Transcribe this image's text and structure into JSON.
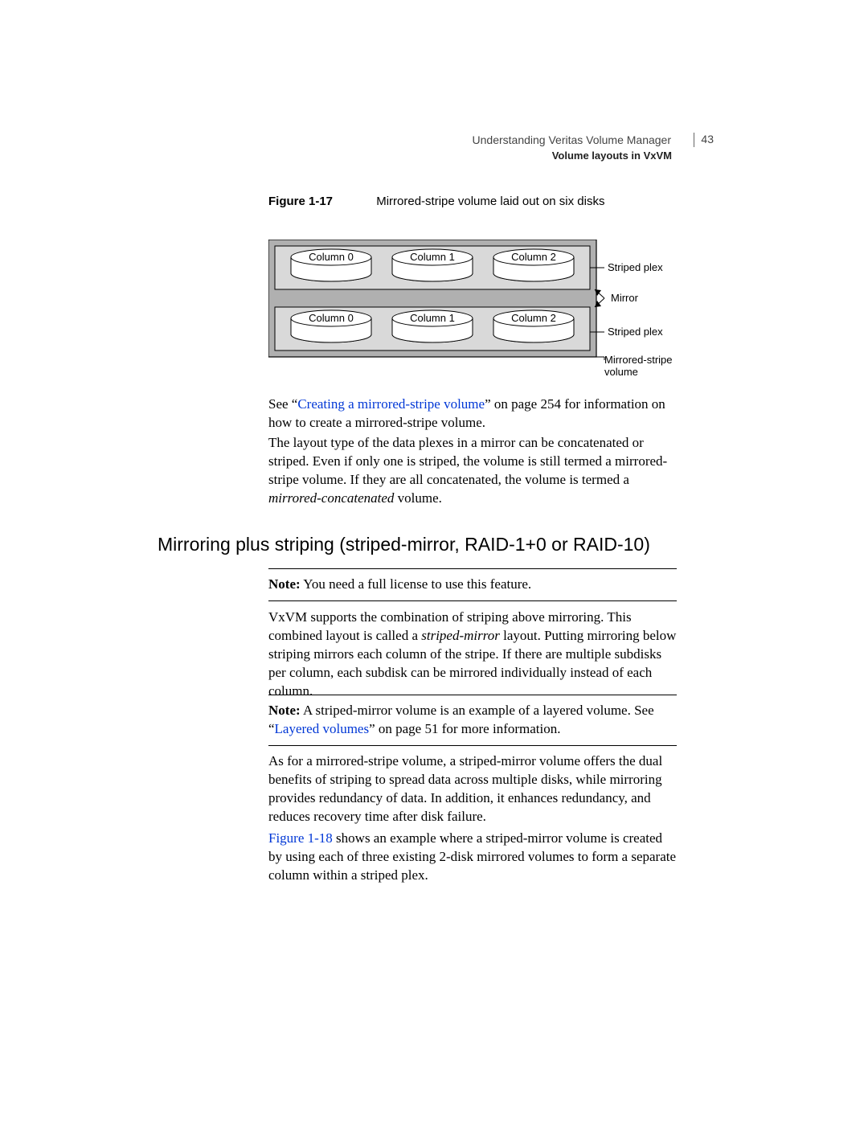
{
  "header": {
    "chapter": "Understanding Veritas Volume Manager",
    "section": "Volume layouts in VxVM",
    "page_number": "43"
  },
  "figure": {
    "label": "Figure 1-17",
    "caption": "Mirrored-stripe volume laid out on six disks",
    "columns": [
      "Column 0",
      "Column 1",
      "Column 2"
    ],
    "annotations": {
      "striped_plex": "Striped plex",
      "mirror": "Mirror",
      "volume": "Mirrored-stripe\nvolume"
    }
  },
  "para1": {
    "pre": "See “",
    "link": "Creating a mirrored-stripe volume",
    "post": "” on page 254 for information on how to create a mirrored-stripe volume."
  },
  "para2": {
    "pre": "The layout type of the data plexes in a mirror can be concatenated or striped. Even if only one is striped, the volume is still termed a mirrored-stripe volume. If they are all concatenated, the volume is termed a ",
    "italic": "mirrored-concatenated",
    "post": " volume."
  },
  "heading": "Mirroring plus striping (striped-mirror, RAID-1+0 or RAID-10)",
  "note1": {
    "label": "Note:",
    "text": " You need a full license to use this feature."
  },
  "para3": {
    "pre": "VxVM supports the combination of striping above mirroring. This combined layout is called a ",
    "italic": "striped-mirror",
    "post": " layout. Putting mirroring below striping mirrors each column of the stripe. If there are multiple subdisks per column, each subdisk can be mirrored individually instead of each column."
  },
  "note2": {
    "label": "Note:",
    "pre": " A striped-mirror volume is an example of a layered volume. See “",
    "link": "Layered volumes",
    "post": "” on page 51 for more information."
  },
  "para4": "As for a mirrored-stripe volume, a striped-mirror volume offers the dual benefits of striping to spread data across multiple disks, while mirroring provides redundancy of data. In addition, it enhances redundancy, and reduces recovery time after disk failure.",
  "para5": {
    "link": "Figure 1-18",
    "post": " shows an example where a striped-mirror volume is created by using each of three existing 2-disk mirrored volumes to form a separate column within a striped plex."
  }
}
